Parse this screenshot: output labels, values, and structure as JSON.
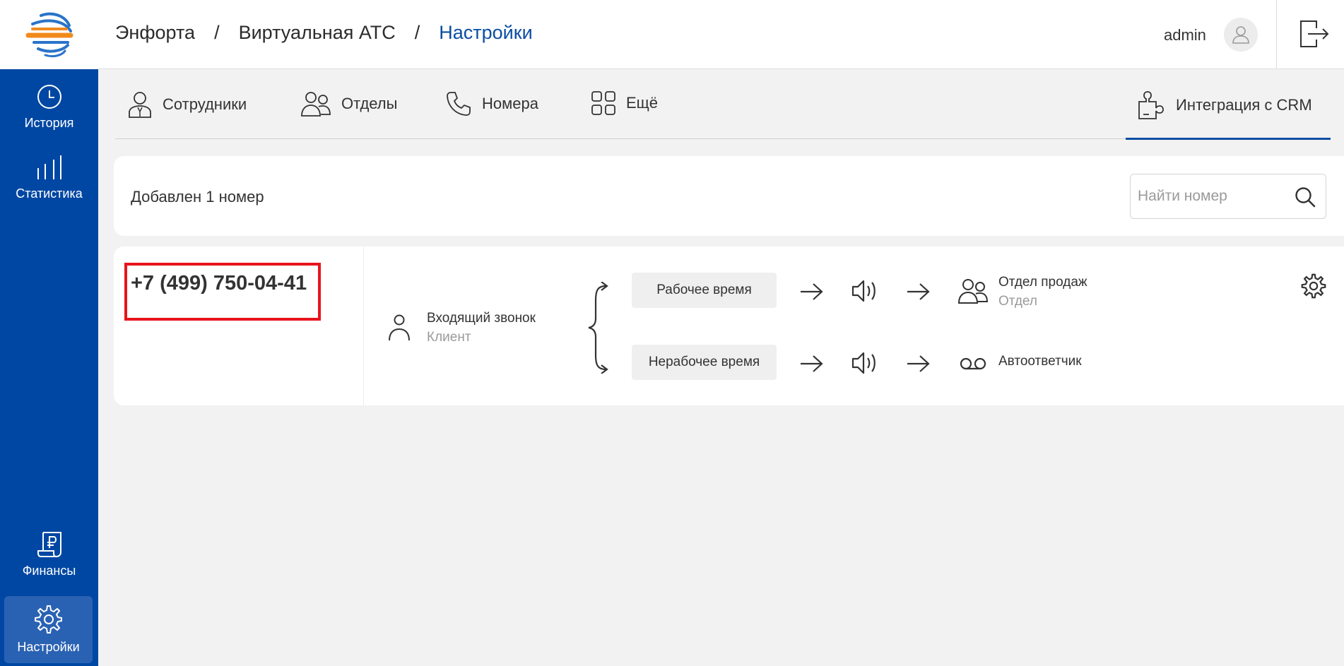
{
  "header": {
    "breadcrumbs": [
      "Энфорта",
      "Виртуальная АТС",
      "Настройки"
    ],
    "user": "admin"
  },
  "sidebar": {
    "items": [
      {
        "label": "История",
        "icon": "clock-icon"
      },
      {
        "label": "Статистика",
        "icon": "bar-chart-icon"
      },
      {
        "label": "Финансы",
        "icon": "ruble-document-icon"
      },
      {
        "label": "Настройки",
        "icon": "gear-icon",
        "active": true
      }
    ]
  },
  "tabs": [
    {
      "label": "Сотрудники",
      "icon": "employee-icon"
    },
    {
      "label": "Отделы",
      "icon": "group-icon"
    },
    {
      "label": "Номера",
      "icon": "phone-icon"
    },
    {
      "label": "Ещё",
      "icon": "grid-icon"
    },
    {
      "label": "Интеграция с CRM",
      "icon": "puzzle-icon",
      "active": true
    }
  ],
  "summary": {
    "added_text": "Добавлен 1 номер",
    "search_placeholder": "Найти номер"
  },
  "number_card": {
    "phone": "+7 (499) 750-04-41",
    "incoming": {
      "title": "Входящий звонок",
      "subtitle": "Клиент"
    },
    "routes": [
      {
        "condition": "Рабочее время",
        "target_title": "Отдел продаж",
        "target_subtitle": "Отдел",
        "target_icon": "group-icon"
      },
      {
        "condition": "Нерабочее время",
        "target_title": "Автоответчик",
        "target_subtitle": "",
        "target_icon": "voicemail-icon"
      }
    ]
  },
  "colors": {
    "sidebar": "#0047a3",
    "accent": "#0a4ea3",
    "highlight": "#e8141c"
  }
}
